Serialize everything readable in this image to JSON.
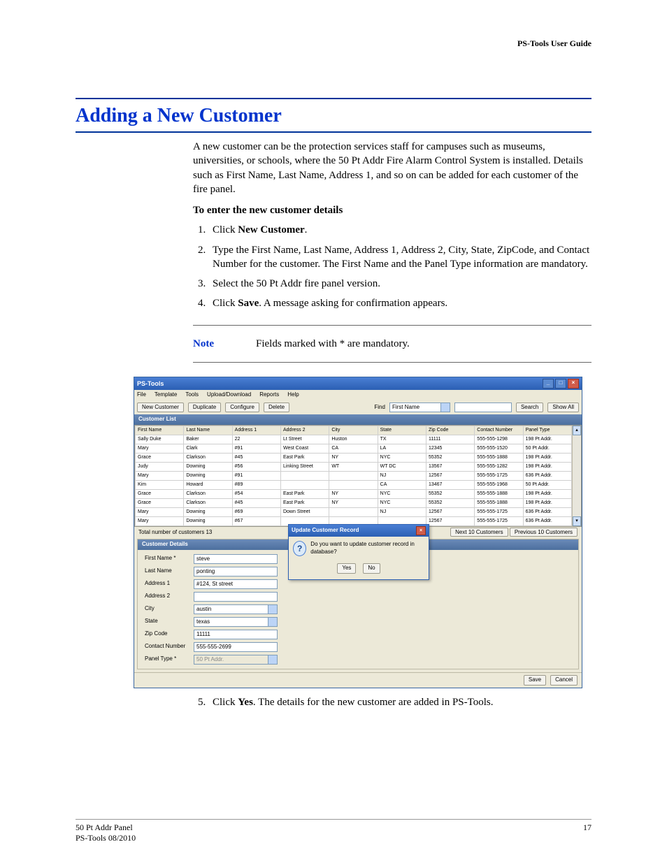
{
  "doc": {
    "header_right": "PS-Tools User Guide",
    "section_title": "Adding a New Customer",
    "intro": "A new customer can be the protection services staff for campuses such as museums, universities, or schools, where the 50 Pt Addr  Fire Alarm Control System is installed. Details such as First Name, Last Name, Address 1, and so on can be added for each customer of the fire panel.",
    "subhead": "To enter the new customer details",
    "steps": {
      "s1a": "Click ",
      "s1b": "New Customer",
      "s1c": ".",
      "s2": "Type the First Name, Last Name, Address 1, Address 2, City, State, ZipCode, and Contact Number for the customer. The First Name and the Panel Type information are mandatory.",
      "s3": "Select the 50 Pt Addr  fire panel version.",
      "s4a": "Click ",
      "s4b": "Save",
      "s4c": ". A message asking for confirmation appears.",
      "s5a": "Click ",
      "s5b": "Yes",
      "s5c": ". The details for the new customer are added in PS-Tools."
    },
    "note_label": "Note",
    "note_text": "Fields marked with * are mandatory.",
    "footer_left1": "50 Pt Addr  Panel",
    "footer_left2": "PS-Tools  08/2010",
    "page_num": "17"
  },
  "app": {
    "title": "PS-Tools",
    "menus": [
      "File",
      "Template",
      "Tools",
      "Upload/Download",
      "Reports",
      "Help"
    ],
    "toolbar": {
      "new_customer": "New Customer",
      "duplicate": "Duplicate",
      "configure": "Configure",
      "delete": "Delete",
      "find_label": "Find",
      "find_field": "First Name",
      "search": "Search",
      "show_all": "Show All"
    },
    "list_head": "Customer List",
    "columns": [
      "First Name",
      "Last Name",
      "Address 1",
      "Address 2",
      "City",
      "State",
      "Zip Code",
      "Contact Number",
      "Panel Type"
    ],
    "rows": [
      [
        "Sally Duke",
        "Baker",
        "22",
        "Lt Street",
        "Huston",
        "TX",
        "11111",
        "555-555-1298",
        "198 Pt Addr."
      ],
      [
        "Mary",
        "Clark",
        "#91",
        "West Coast",
        "CA",
        "LA",
        "12345",
        "555-555-1520",
        "50 Pt Addr."
      ],
      [
        "Grace",
        "Clarkson",
        "#45",
        "East Park",
        "NY",
        "NYC",
        "55352",
        "555-555-1888",
        "198 Pt Addr."
      ],
      [
        "Judy",
        "Downing",
        "#56",
        "Linking Street",
        "WT",
        "WT DC",
        "13567",
        "555-555-1282",
        "198 Pt Addr."
      ],
      [
        "Mary",
        "Downing",
        "#91",
        "",
        "",
        "NJ",
        "12567",
        "555-555-1725",
        "636 Pt Addr."
      ],
      [
        "Kim",
        "Howard",
        "#89",
        "",
        "",
        "CA",
        "13467",
        "555-555-1968",
        "50 Pt Addr."
      ],
      [
        "Grace",
        "Clarkson",
        "#54",
        "East Park",
        "NY",
        "NYC",
        "55352",
        "555-555-1888",
        "198 Pt Addr."
      ],
      [
        "Grace",
        "Clarkson",
        "#45",
        "East Park",
        "NY",
        "NYC",
        "55352",
        "555-555-1888",
        "198 Pt Addr."
      ],
      [
        "Mary",
        "Downing",
        "#69",
        "Down Street",
        "",
        "NJ",
        "12567",
        "555-555-1725",
        "636 Pt Addr."
      ],
      [
        "Mary",
        "Downing",
        "#67",
        "",
        "",
        "",
        "12567",
        "555-555-1725",
        "636 Pt Addr."
      ]
    ],
    "total_text": "Total number of customers 13",
    "next_btn": "Next 10 Customers",
    "prev_btn": "Previous 10 Customers",
    "details_head": "Customer Details",
    "fields": {
      "first_name_label": "First Name *",
      "first_name": "steve",
      "last_name_label": "Last Name",
      "last_name": "ponting",
      "addr1_label": "Address 1",
      "addr1": "#124, St street",
      "addr2_label": "Address 2",
      "addr2": "",
      "city_label": "City",
      "city": "austin",
      "state_label": "State",
      "state": "texas",
      "zip_label": "Zip Code",
      "zip": "11111",
      "contact_label": "Contact Number",
      "contact": "555-555-2699",
      "panel_label": "Panel Type *",
      "panel": "50 Pt Addr."
    },
    "save": "Save",
    "cancel": "Cancel",
    "modal": {
      "title": "Update Customer Record",
      "text": "Do you want to update customer record in database?",
      "yes": "Yes",
      "no": "No"
    }
  }
}
